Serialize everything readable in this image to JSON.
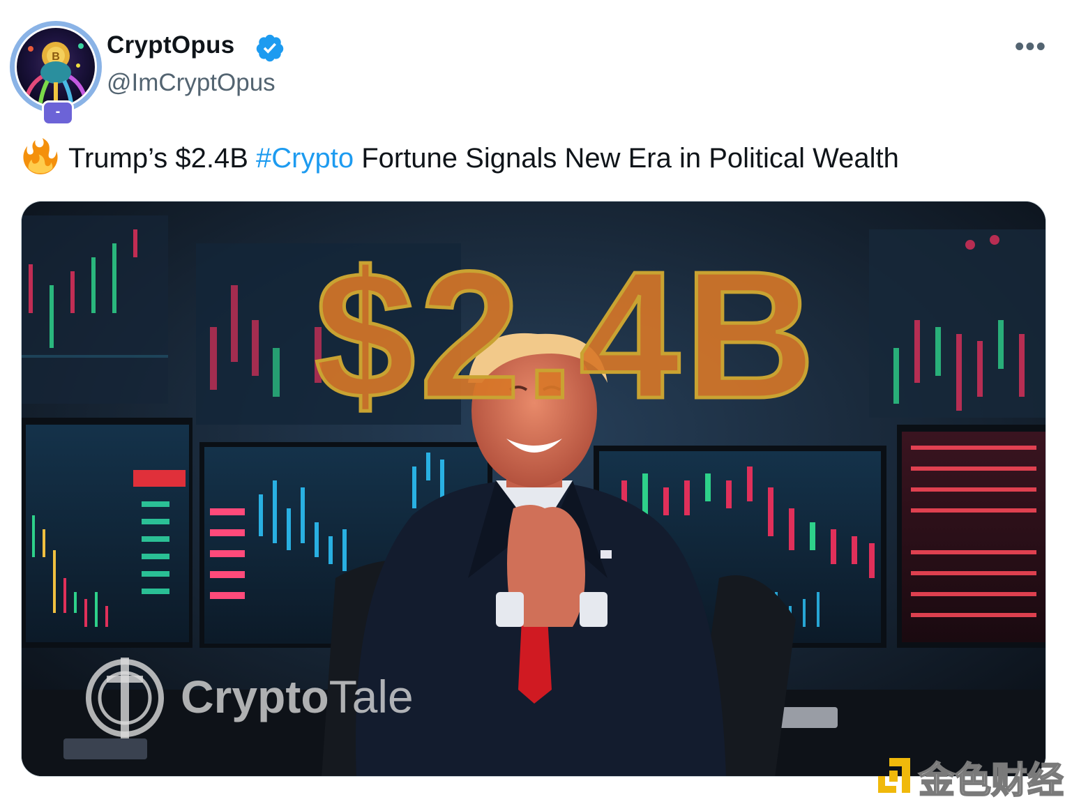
{
  "author": {
    "display_name": "CryptOpus",
    "handle": "@ImCryptOpus",
    "verified": true,
    "avatar_badge": "-",
    "avatar_icon": "octopus-bitcoin-avatar",
    "verified_icon": "verified-badge-icon"
  },
  "post": {
    "emoji": "fire-emoji",
    "text_before": "Trump’s $2.4B ",
    "hashtag": "#Crypto",
    "text_after": " Fortune Signals New Era in Political Wealth"
  },
  "media": {
    "headline_overlay": "$2.4B",
    "brand_watermark_bold": "Crypto",
    "brand_watermark_light": "Tale"
  },
  "corner_watermark": "金色财经",
  "menu_icon": "more-options-icon",
  "colors": {
    "hashtag": "#1d9bf0",
    "verified": "#1d9bf0",
    "text_primary": "#0f1419",
    "text_secondary": "#536471"
  }
}
